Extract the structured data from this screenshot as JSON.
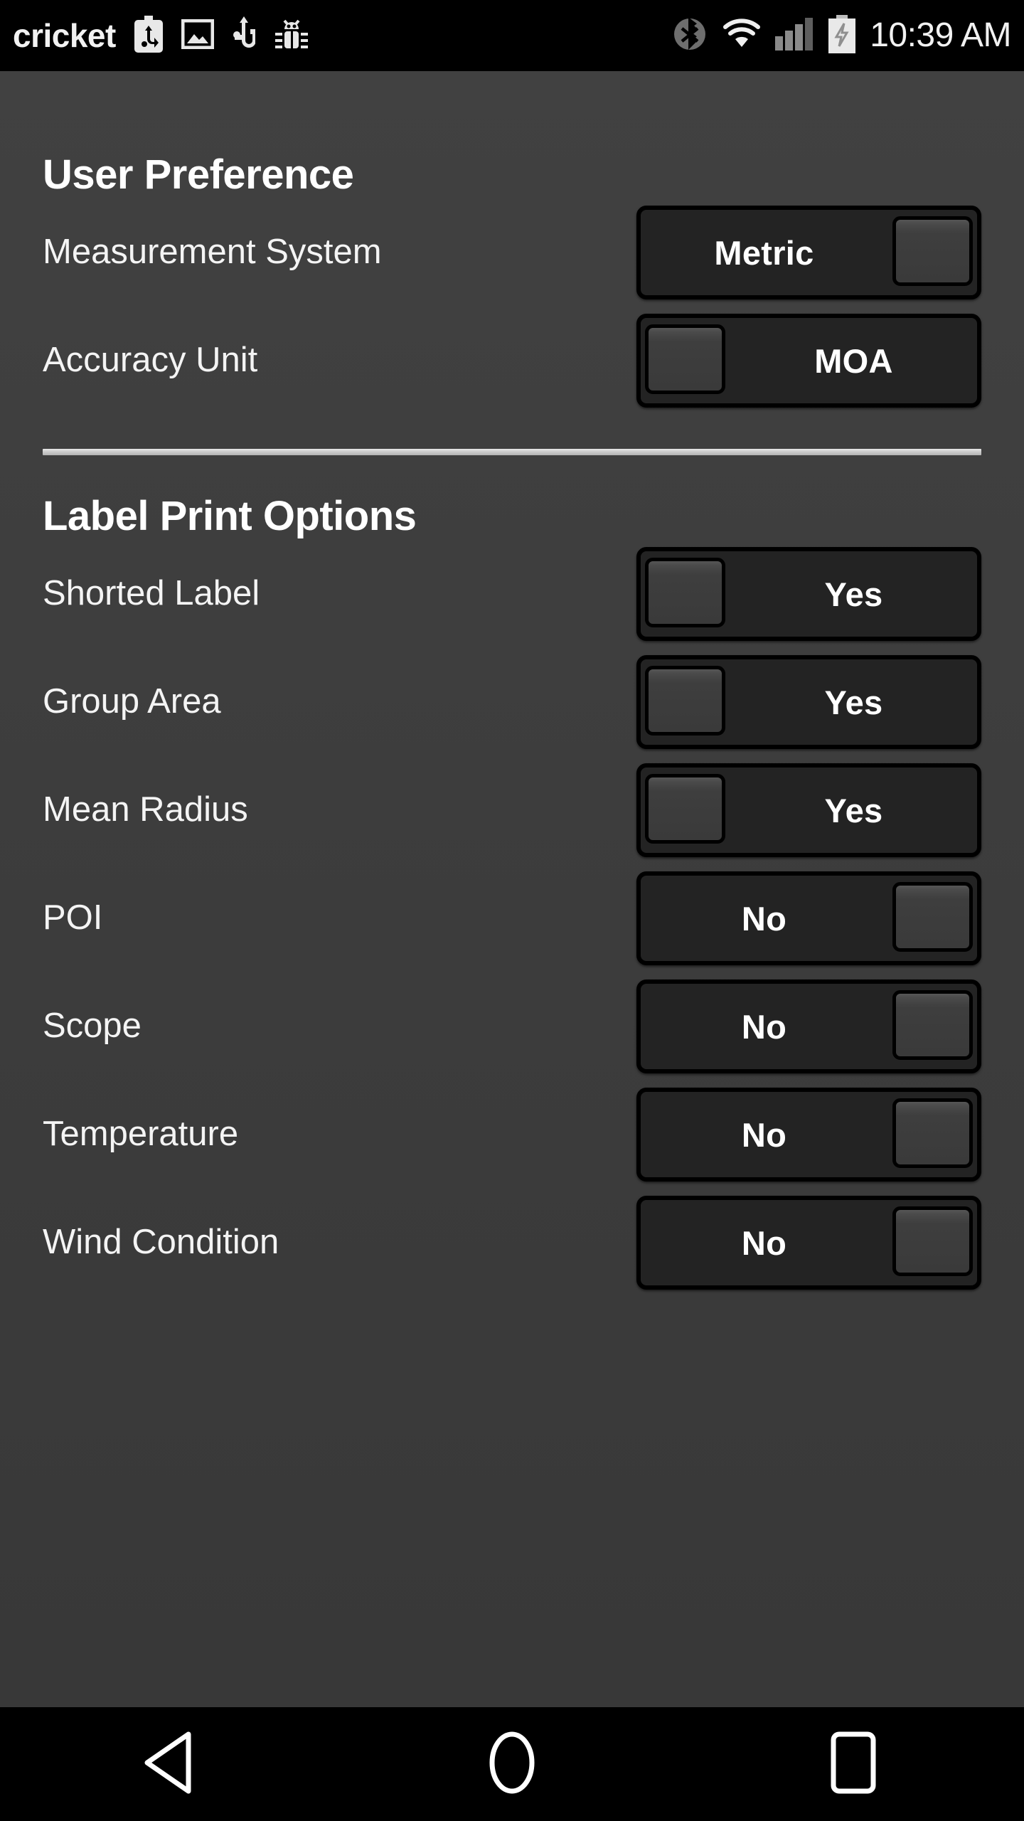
{
  "status_bar": {
    "carrier": "cricket",
    "time": "10:39 AM",
    "left_icons": [
      "usb-battery-icon",
      "image-icon",
      "usb-icon",
      "bug-icon"
    ],
    "right_icons": [
      "bluetooth-icon",
      "wifi-icon",
      "signal-icon",
      "battery-charging-icon"
    ],
    "background_color": "#000000",
    "text_color": "#f2f2f2"
  },
  "theme": {
    "page_background": "#3d3d3d",
    "text_color": "#f4f4f4",
    "toggle_track": "#232323",
    "toggle_border": "#000000",
    "toggle_thumb": "#3e3e3e",
    "divider_color": "#cfcfcf"
  },
  "sections": [
    {
      "title": "User Preference",
      "rows": [
        {
          "label": "Measurement System",
          "value": "Metric",
          "thumb_position": "right"
        },
        {
          "label": "Accuracy Unit",
          "value": "MOA",
          "thumb_position": "left"
        }
      ]
    },
    {
      "title": "Label Print Options",
      "rows": [
        {
          "label": "Shorted Label",
          "value": "Yes",
          "thumb_position": "left"
        },
        {
          "label": "Group Area",
          "value": "Yes",
          "thumb_position": "left"
        },
        {
          "label": "Mean Radius",
          "value": "Yes",
          "thumb_position": "left"
        },
        {
          "label": "POI",
          "value": "No",
          "thumb_position": "right"
        },
        {
          "label": "Scope",
          "value": "No",
          "thumb_position": "right"
        },
        {
          "label": "Temperature",
          "value": "No",
          "thumb_position": "right"
        },
        {
          "label": "Wind Condition",
          "value": "No",
          "thumb_position": "right"
        }
      ]
    }
  ],
  "nav_bar": {
    "back_label": "Back",
    "home_label": "Home",
    "recents_label": "Recent apps"
  }
}
